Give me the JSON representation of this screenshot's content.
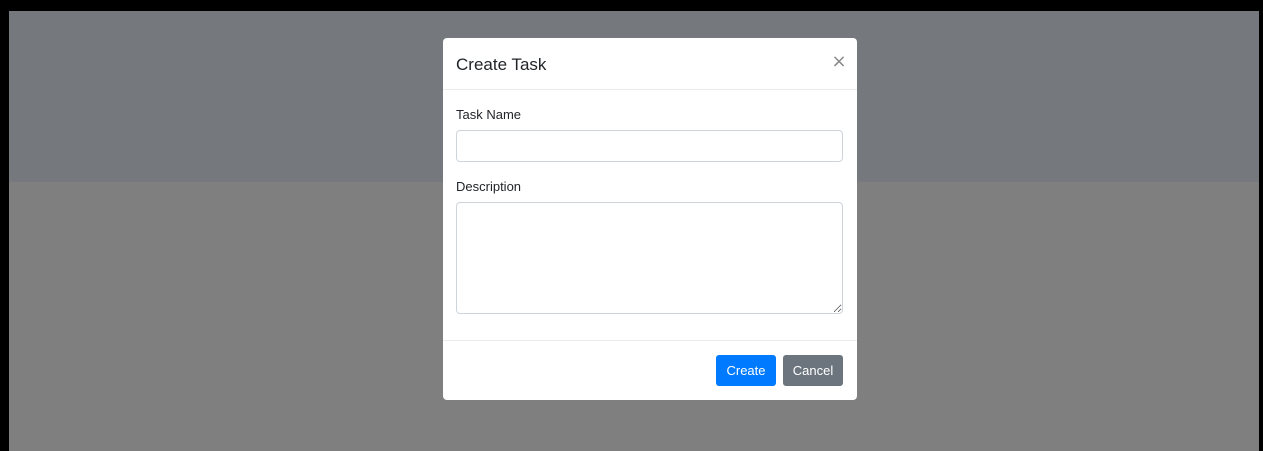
{
  "modal": {
    "title": "Create Task",
    "close_label": "×",
    "fields": {
      "task_name": {
        "label": "Task Name",
        "value": "",
        "placeholder": ""
      },
      "description": {
        "label": "Description",
        "value": "",
        "placeholder": ""
      }
    },
    "buttons": {
      "create_label": "Create",
      "cancel_label": "Cancel"
    }
  },
  "colors": {
    "primary": "#007bff",
    "secondary": "#6c757d",
    "backdrop": "#7f7f7f",
    "frame": "#000000"
  },
  "icons": {
    "close": "close-icon"
  }
}
